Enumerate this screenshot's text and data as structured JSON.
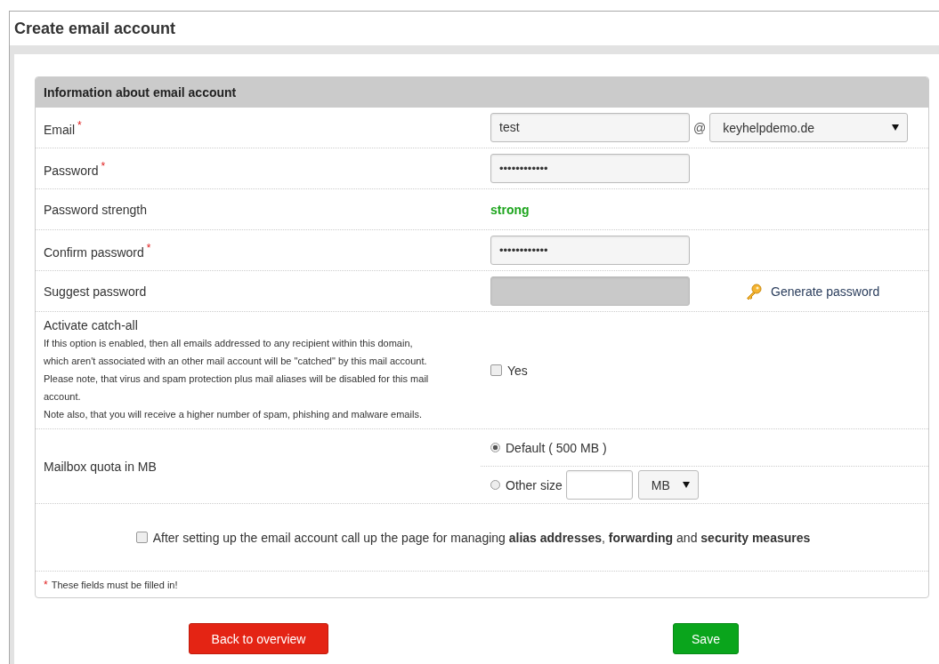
{
  "page_title": "Create email account",
  "section": {
    "title": "Information about email account"
  },
  "required_mark": "*",
  "rows": [
    {
      "kind": "email",
      "label": "Email",
      "required": true,
      "value": "test",
      "separator": "@",
      "domain": "keyhelpdemo.de"
    },
    {
      "kind": "password",
      "label": "Password",
      "required": true,
      "value": "••••••••••••"
    },
    {
      "kind": "strength",
      "label": "Password strength",
      "required": false,
      "value": "strong"
    },
    {
      "kind": "password",
      "label": "Confirm password",
      "required": true,
      "value": "••••••••••••"
    },
    {
      "kind": "suggest",
      "label": "Suggest password",
      "required": false,
      "action": "Generate password"
    },
    {
      "kind": "catchall",
      "label": "Activate catch-all",
      "required": false,
      "description": [
        "If this option is enabled, then all emails addressed to any recipient within this domain,",
        "which aren't associated with an other mail account will be \"catched\" by this mail account.",
        "Please note, that virus and spam protection plus mail aliases will be disabled for this mail",
        "account.",
        "Note also, that you will receive a higher number of spam, phishing and malware emails."
      ],
      "option": "Yes",
      "checked": false
    },
    {
      "kind": "quota",
      "label": "Mailbox quota in MB",
      "required": false,
      "options": [
        {
          "label": "Default ( 500 MB )",
          "selected": true
        },
        {
          "label": "Other size",
          "selected": false
        }
      ],
      "unit": "MB"
    }
  ],
  "followup": {
    "checked": false,
    "text": "After setting up the email account call up the page for managing **alias addresses**, **forwarding** and **security measures**"
  },
  "footnote": {
    "mark": "*",
    "text": "These fields must be filled in!"
  },
  "buttons": [
    {
      "kind": "back",
      "label": "Back to overview"
    },
    {
      "kind": "save",
      "label": "Save"
    }
  ]
}
